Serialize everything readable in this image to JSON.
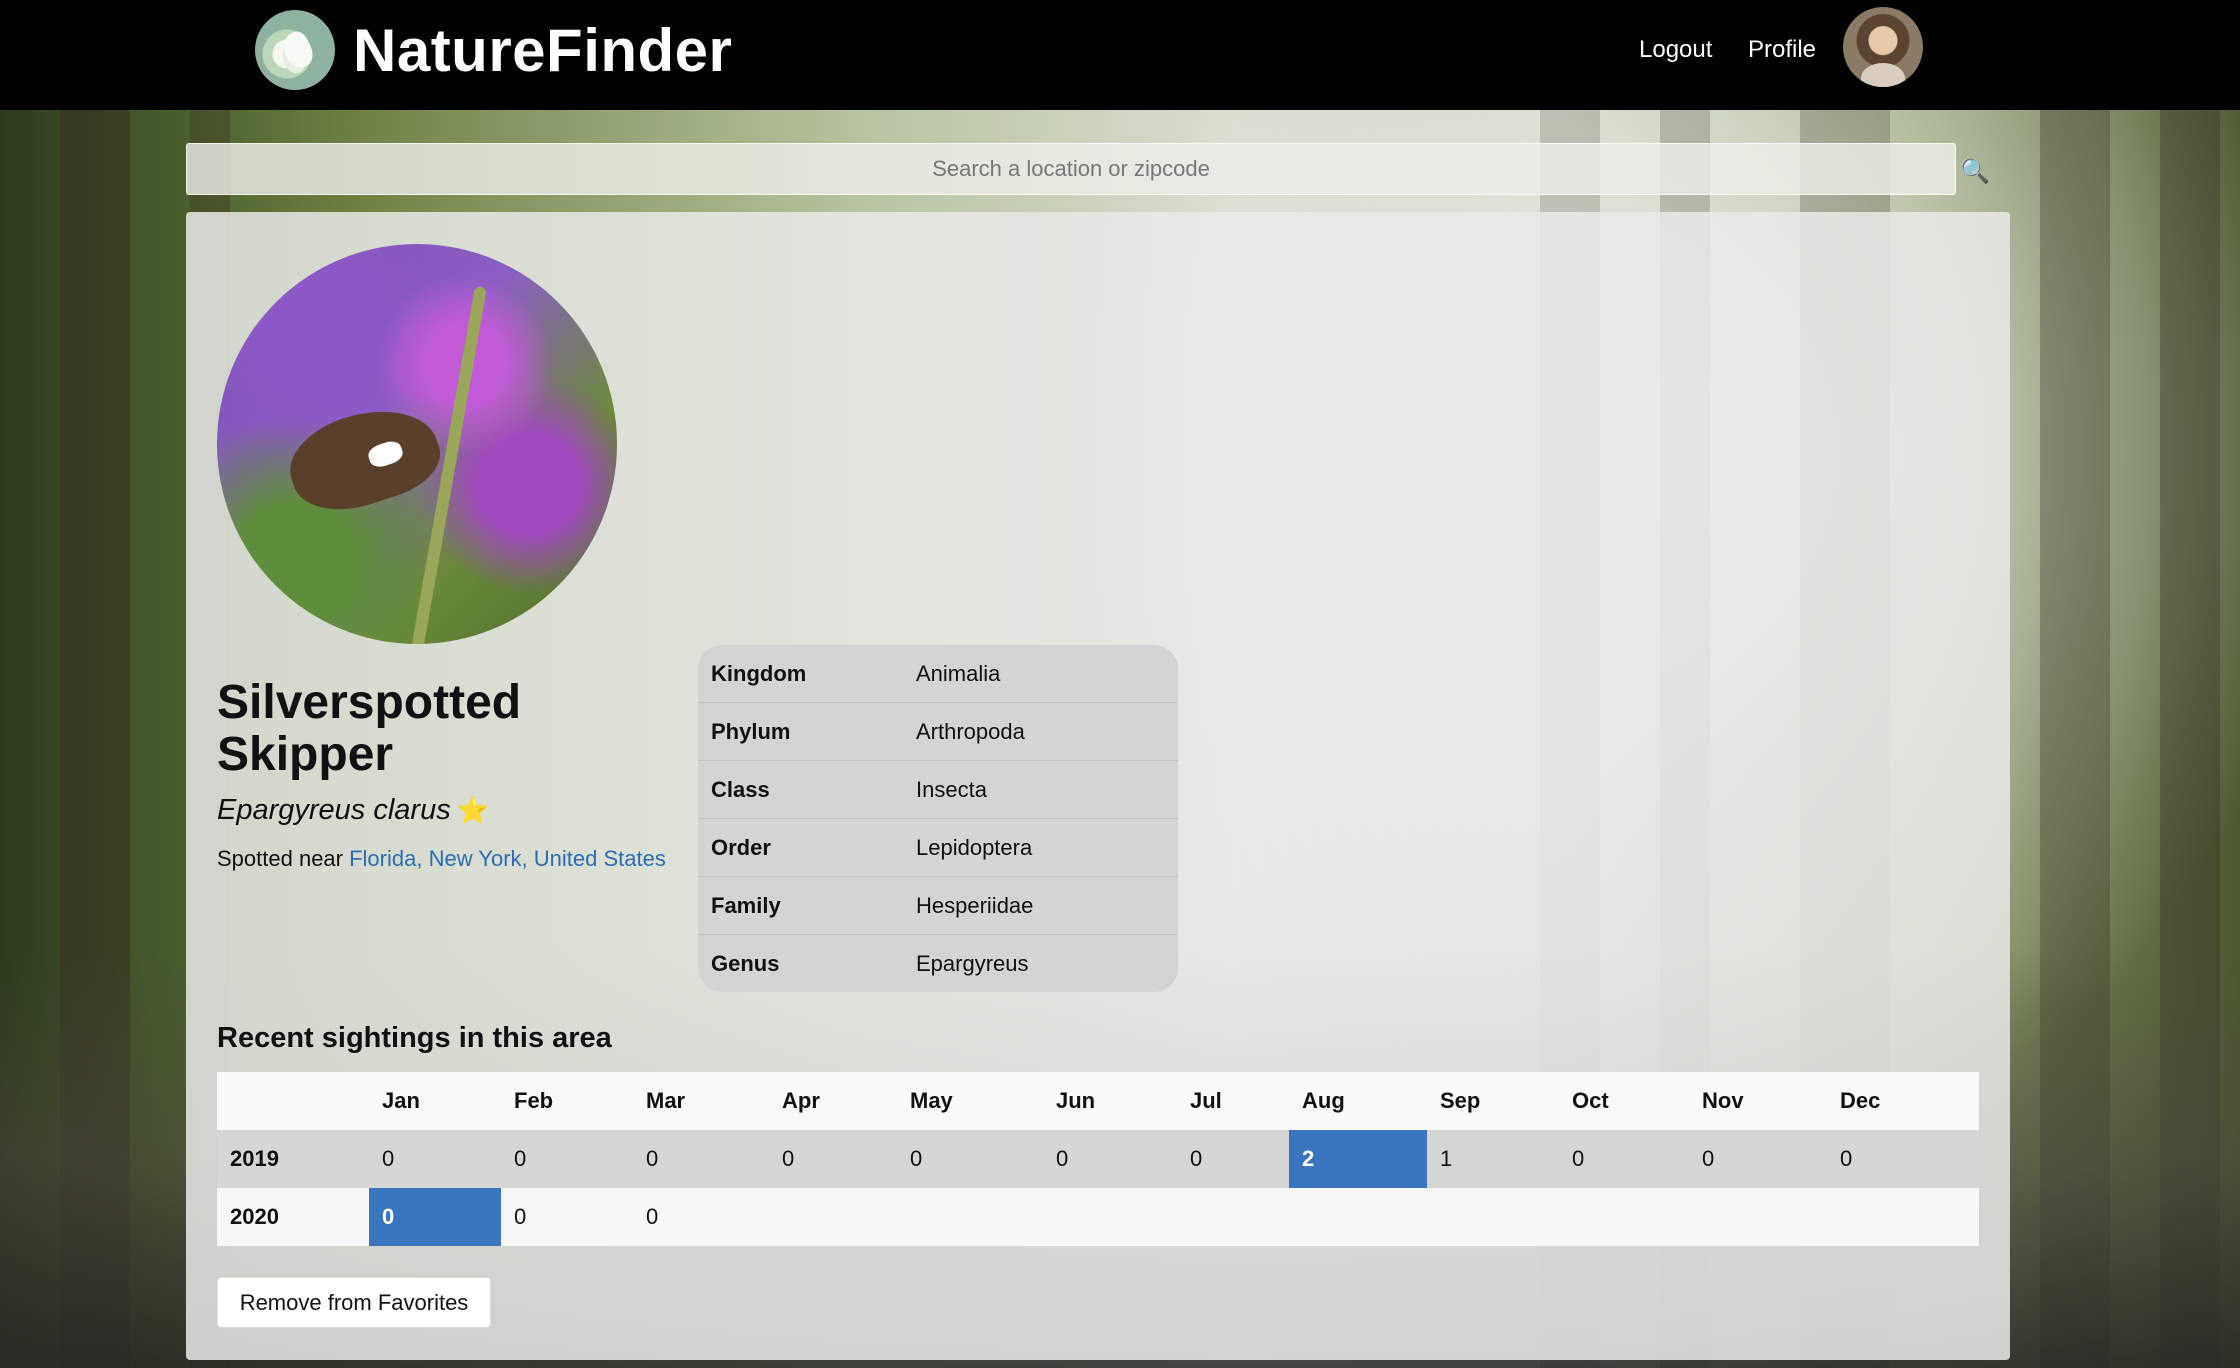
{
  "navbar": {
    "brand": "NatureFinder",
    "logout": "Logout",
    "profile": "Profile"
  },
  "search": {
    "placeholder": "Search a location or zipcode",
    "icon": "search-icon"
  },
  "species": {
    "common_name": "Silverspotted Skipper",
    "scientific_name": "Epargyreus clarus",
    "favorite_icon": "star-icon",
    "spotted_prefix": "Spotted near",
    "location": "Florida, New York, United States"
  },
  "taxonomy": [
    {
      "key": "Kingdom",
      "value": "Animalia"
    },
    {
      "key": "Phylum",
      "value": "Arthropoda"
    },
    {
      "key": "Class",
      "value": "Insecta"
    },
    {
      "key": "Order",
      "value": "Lepidoptera"
    },
    {
      "key": "Family",
      "value": "Hesperiidae"
    },
    {
      "key": "Genus",
      "value": "Epargyreus"
    }
  ],
  "sightings": {
    "title": "Recent sightings in this area",
    "months": [
      "Jan",
      "Feb",
      "Mar",
      "Apr",
      "May",
      "Jun",
      "Jul",
      "Aug",
      "Sep",
      "Oct",
      "Nov",
      "Dec"
    ],
    "rows": [
      {
        "year": "2019",
        "counts": [
          "0",
          "0",
          "0",
          "0",
          "0",
          "0",
          "0",
          "2",
          "1",
          "0",
          "0",
          "0"
        ],
        "highlight_month": "Aug"
      },
      {
        "year": "2020",
        "counts": [
          "0",
          "0",
          "0",
          "",
          "",
          "",
          "",
          "",
          "",
          "",
          "",
          ""
        ],
        "highlight_month": "Jan"
      }
    ],
    "highlight_color": "#3a76c0"
  },
  "actions": {
    "remove_favorite": "Remove from Favorites"
  }
}
